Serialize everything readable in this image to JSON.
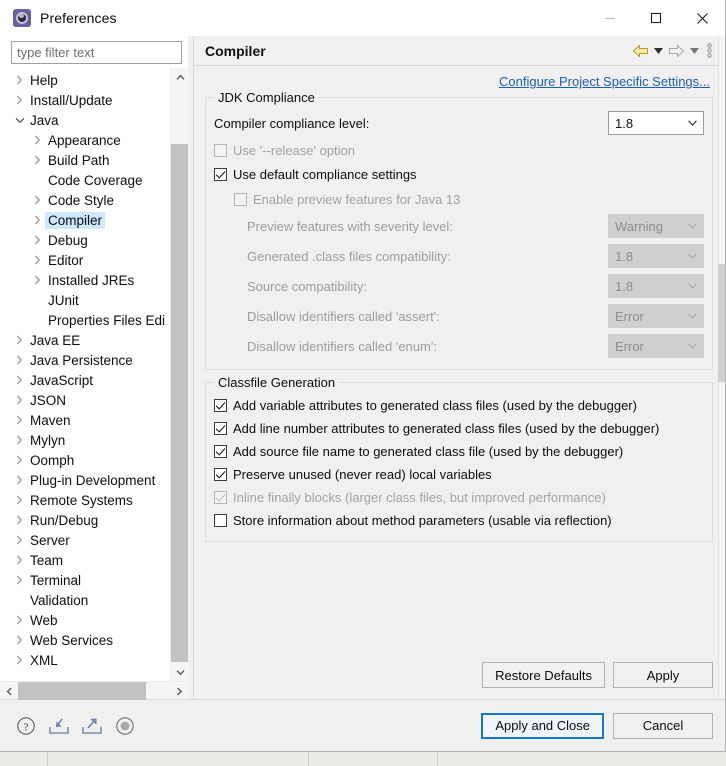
{
  "window": {
    "title": "Preferences",
    "icon": "preferences-gear-icon",
    "controls": {
      "minimize": "minimize-icon",
      "maximize": "maximize-icon",
      "close": "close-icon"
    }
  },
  "filter": {
    "placeholder": "type filter text",
    "value": ""
  },
  "tree": {
    "items": [
      {
        "label": "Help",
        "level": 1,
        "arrow": "collapsed",
        "selected": false
      },
      {
        "label": "Install/Update",
        "level": 1,
        "arrow": "collapsed",
        "selected": false
      },
      {
        "label": "Java",
        "level": 1,
        "arrow": "expanded",
        "selected": false
      },
      {
        "label": "Appearance",
        "level": 2,
        "arrow": "collapsed",
        "selected": false
      },
      {
        "label": "Build Path",
        "level": 2,
        "arrow": "collapsed",
        "selected": false
      },
      {
        "label": "Code Coverage",
        "level": 2,
        "arrow": "none",
        "selected": false
      },
      {
        "label": "Code Style",
        "level": 2,
        "arrow": "collapsed",
        "selected": false
      },
      {
        "label": "Compiler",
        "level": 2,
        "arrow": "collapsed",
        "selected": true
      },
      {
        "label": "Debug",
        "level": 2,
        "arrow": "collapsed",
        "selected": false
      },
      {
        "label": "Editor",
        "level": 2,
        "arrow": "collapsed",
        "selected": false
      },
      {
        "label": "Installed JREs",
        "level": 2,
        "arrow": "collapsed",
        "selected": false
      },
      {
        "label": "JUnit",
        "level": 2,
        "arrow": "none",
        "selected": false
      },
      {
        "label": "Properties Files Edi",
        "level": 2,
        "arrow": "none",
        "selected": false
      },
      {
        "label": "Java EE",
        "level": 1,
        "arrow": "collapsed",
        "selected": false
      },
      {
        "label": "Java Persistence",
        "level": 1,
        "arrow": "collapsed",
        "selected": false
      },
      {
        "label": "JavaScript",
        "level": 1,
        "arrow": "collapsed",
        "selected": false
      },
      {
        "label": "JSON",
        "level": 1,
        "arrow": "collapsed",
        "selected": false
      },
      {
        "label": "Maven",
        "level": 1,
        "arrow": "collapsed",
        "selected": false
      },
      {
        "label": "Mylyn",
        "level": 1,
        "arrow": "collapsed",
        "selected": false
      },
      {
        "label": "Oomph",
        "level": 1,
        "arrow": "collapsed",
        "selected": false
      },
      {
        "label": "Plug-in Development",
        "level": 1,
        "arrow": "collapsed",
        "selected": false
      },
      {
        "label": "Remote Systems",
        "level": 1,
        "arrow": "collapsed",
        "selected": false
      },
      {
        "label": "Run/Debug",
        "level": 1,
        "arrow": "collapsed",
        "selected": false
      },
      {
        "label": "Server",
        "level": 1,
        "arrow": "collapsed",
        "selected": false
      },
      {
        "label": "Team",
        "level": 1,
        "arrow": "collapsed",
        "selected": false
      },
      {
        "label": "Terminal",
        "level": 1,
        "arrow": "collapsed",
        "selected": false
      },
      {
        "label": "Validation",
        "level": 1,
        "arrow": "none",
        "selected": false
      },
      {
        "label": "Web",
        "level": 1,
        "arrow": "collapsed",
        "selected": false
      },
      {
        "label": "Web Services",
        "level": 1,
        "arrow": "collapsed",
        "selected": false
      },
      {
        "label": "XML",
        "level": 1,
        "arrow": "collapsed",
        "selected": false
      }
    ]
  },
  "page": {
    "title": "Compiler",
    "toolbar": {
      "back": "back-arrow-icon",
      "back_menu": "chevron-down-icon",
      "forward": "forward-arrow-icon",
      "forward_menu": "chevron-down-icon",
      "view_menu": "view-menu-icon"
    },
    "project_specific_link": "Configure Project Specific Settings...",
    "jdk_compliance": {
      "legend": "JDK Compliance",
      "compliance_level_label": "Compiler compliance level:",
      "compliance_level_value": "1.8",
      "use_release_label": "Use '--release' option",
      "use_release_checked": false,
      "use_release_enabled": false,
      "use_default_label": "Use default compliance settings",
      "use_default_checked": true,
      "enable_preview_label": "Enable preview features for Java 13",
      "enable_preview_checked": false,
      "preview_severity_label": "Preview features with severity level:",
      "preview_severity_value": "Warning",
      "class_files_label": "Generated .class files compatibility:",
      "class_files_value": "1.8",
      "source_compat_label": "Source compatibility:",
      "source_compat_value": "1.8",
      "assert_label": "Disallow identifiers called 'assert':",
      "assert_value": "Error",
      "enum_label": "Disallow identifiers called 'enum':",
      "enum_value": "Error"
    },
    "classfile_generation": {
      "legend": "Classfile Generation",
      "options": [
        {
          "label": "Add variable attributes to generated class files (used by the debugger)",
          "checked": true,
          "enabled": true
        },
        {
          "label": "Add line number attributes to generated class files (used by the debugger)",
          "checked": true,
          "enabled": true
        },
        {
          "label": "Add source file name to generated class file (used by the debugger)",
          "checked": true,
          "enabled": true
        },
        {
          "label": "Preserve unused (never read) local variables",
          "checked": true,
          "enabled": true
        },
        {
          "label": "Inline finally blocks (larger class files, but improved performance)",
          "checked": true,
          "enabled": false
        },
        {
          "label": "Store information about method parameters (usable via reflection)",
          "checked": false,
          "enabled": true
        }
      ]
    },
    "buttons": {
      "restore_defaults": "Restore Defaults",
      "apply": "Apply"
    }
  },
  "footer": {
    "icons": [
      {
        "name": "help-icon"
      },
      {
        "name": "import-icon"
      },
      {
        "name": "export-icon"
      },
      {
        "name": "record-icon"
      }
    ],
    "apply_and_close": "Apply and Close",
    "cancel": "Cancel"
  }
}
